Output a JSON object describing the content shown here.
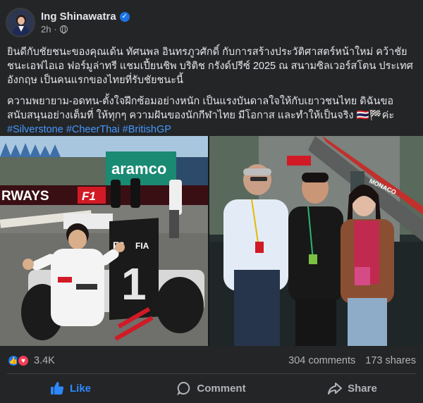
{
  "post": {
    "author": "Ing Shinawatra",
    "time": "2h",
    "paragraph1": "ยินดีกับชัยชนะของคุณเด้น ทัศนพล อินทรภูวศักดิ์ กับการสร้างประวัติศาสตร์หน้าใหม่ คว้าชัยชนะเอฟไอเอ ฟอร์มูล่าทรี แชมเปี้ยนชิพ บริติช กรังด์ปรีซ์ 2025 ณ สนามซิลเวอร์สโตน ประเทศอังกฤษ เป็นคนแรกของไทยที่รับชัยชนะนี้",
    "paragraph2": "ความพยายาม-อดทน-ตั้งใจฝึกซ้อมอย่างหนัก เป็นแรงบันดาลใจให้กับเยาวชนไทย ดิฉันขอสนับสนุนอย่างเต็มที่ ให้ทุกๆ ความฝันของนักกีฬาไทย มีโอกาส และทำให้เป็นจริง 🇹🇭🏁ค่ะ",
    "hashtags": [
      "#Silverstone",
      "#CheerThai",
      "#BritishGP"
    ]
  },
  "images": {
    "left_sign": "aramco",
    "left_banner": "RWAYS",
    "left_f1": "F1",
    "left_number": "1",
    "left_board_logo": "F3",
    "left_fia": "FIA",
    "right_overlay": "MONACO"
  },
  "engagement": {
    "reactions": "3.4K",
    "comments": "304 comments",
    "shares": "173 shares"
  },
  "actions": {
    "like": "Like",
    "comment": "Comment",
    "share": "Share"
  },
  "colors": {
    "background": "#242526",
    "accent": "#2d88ff",
    "hashtag": "#4599ff"
  }
}
